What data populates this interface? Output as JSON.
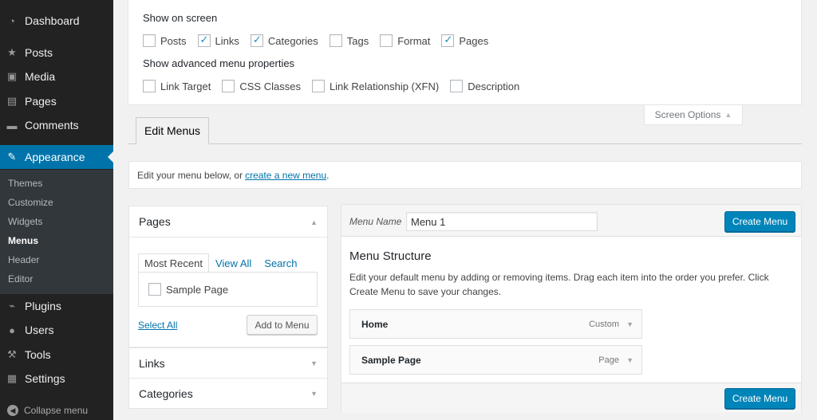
{
  "sidebar": {
    "items": [
      {
        "label": "Dashboard",
        "icon": "dashboard-icon",
        "glyph": "◔"
      },
      {
        "label": "Posts",
        "icon": "pushpin-icon",
        "glyph": "★"
      },
      {
        "label": "Media",
        "icon": "media-icon",
        "glyph": "▣"
      },
      {
        "label": "Pages",
        "icon": "pages-icon",
        "glyph": "▤"
      },
      {
        "label": "Comments",
        "icon": "comment-icon",
        "glyph": "▬"
      },
      {
        "label": "Appearance",
        "icon": "paintbrush-icon",
        "glyph": "✎"
      },
      {
        "label": "Plugins",
        "icon": "plug-icon",
        "glyph": "⌁"
      },
      {
        "label": "Users",
        "icon": "users-icon",
        "glyph": "●"
      },
      {
        "label": "Tools",
        "icon": "wrench-icon",
        "glyph": "⚒"
      },
      {
        "label": "Settings",
        "icon": "settings-icon",
        "glyph": "▦"
      }
    ],
    "submenu": [
      "Themes",
      "Customize",
      "Widgets",
      "Menus",
      "Header",
      "Editor"
    ],
    "current_submenu": "Menus",
    "collapse_label": "Collapse menu"
  },
  "screen_options": {
    "show_on_screen_heading": "Show on screen",
    "show_on_screen": [
      {
        "label": "Posts",
        "checked": false
      },
      {
        "label": "Links",
        "checked": true
      },
      {
        "label": "Categories",
        "checked": true
      },
      {
        "label": "Tags",
        "checked": false
      },
      {
        "label": "Format",
        "checked": false
      },
      {
        "label": "Pages",
        "checked": true
      }
    ],
    "advanced_heading": "Show advanced menu properties",
    "advanced": [
      {
        "label": "Link Target",
        "checked": false
      },
      {
        "label": "CSS Classes",
        "checked": false
      },
      {
        "label": "Link Relationship (XFN)",
        "checked": false
      },
      {
        "label": "Description",
        "checked": false
      }
    ],
    "toggle_label": "Screen Options"
  },
  "nav_tab": {
    "label": "Edit Menus"
  },
  "manage": {
    "text": "Edit your menu below, or",
    "link": "create a new menu",
    "suffix": "."
  },
  "left": {
    "pages_heading": "Pages",
    "tabs": {
      "most_recent": "Most Recent",
      "view_all": "View All",
      "search": "Search"
    },
    "page_items": [
      {
        "label": "Sample Page",
        "checked": false
      }
    ],
    "select_all": "Select All",
    "add_button": "Add to Menu",
    "links_heading": "Links",
    "categories_heading": "Categories"
  },
  "right": {
    "menu_name_label": "Menu Name",
    "menu_name_value": "Menu 1",
    "create_button": "Create Menu",
    "structure_title": "Menu Structure",
    "structure_desc": "Edit your default menu by adding or removing items. Drag each item into the order you prefer. Click Create Menu to save your changes.",
    "items": [
      {
        "title": "Home",
        "type": "Custom"
      },
      {
        "title": "Sample Page",
        "type": "Page"
      }
    ],
    "footer_button": "Create Menu"
  },
  "colors": {
    "accent": "#0073aa",
    "primary_button": "#0085ba",
    "sidebar": "#222222"
  }
}
